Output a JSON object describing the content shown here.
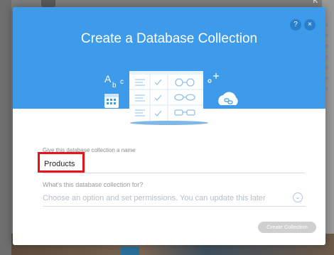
{
  "background": {
    "topright_text": "K",
    "right_list": [
      "an",
      "an",
      "an",
      "an",
      "an",
      "on",
      "on",
      "U"
    ]
  },
  "modal": {
    "title": "Create a Database Collection",
    "help_icon": "?",
    "close_icon": "×",
    "illustration_letters": [
      "A",
      "b",
      "c"
    ],
    "name_label": "Give this database collection a name",
    "name_value": "Products",
    "purpose_label": "What's this database collection for?",
    "purpose_placeholder": "Choose an option and set permissions. You can update this later",
    "chevron_icon": "⌄",
    "create_button": "Create Collection"
  },
  "colors": {
    "header_blue": "#3d9be9",
    "highlight_red": "#e3141b",
    "disabled_button": "#cfcfcf"
  }
}
